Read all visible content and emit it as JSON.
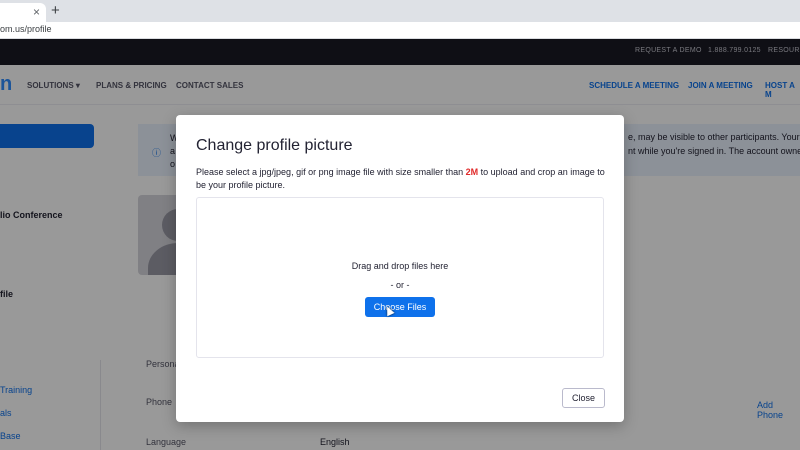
{
  "browser": {
    "tab_close": "×",
    "new_tab": "+",
    "url": "om.us/profile"
  },
  "topbar": {
    "request_demo": "REQUEST A DEMO",
    "phone": "1.888.799.0125",
    "resources": "RESOUR"
  },
  "nav": {
    "logo_fragment": "n",
    "solutions": "SOLUTIONS ▾",
    "plans": "PLANS & PRICING",
    "contact": "CONTACT SALES",
    "schedule": "SCHEDULE A MEETING",
    "join": "JOIN A MEETING",
    "host": "HOST A M"
  },
  "background": {
    "sidebar_conference": "lio Conference",
    "sidebar_profile": "file",
    "sidebar_training": "Training",
    "sidebar_als": "als",
    "sidebar_base": "Base",
    "notice_line1": "e, may be visible to other participants. Your na",
    "notice_line2": "nt while you're signed in. The account owner a",
    "notice_w": "W",
    "notice_a": "a",
    "notice_o": "o",
    "personal": "Persona",
    "phone_label": "Phone",
    "add_phone": "Add Phone",
    "language_label": "Language",
    "language_value": "English"
  },
  "modal": {
    "title": "Change profile picture",
    "desc_before": "Please select a jpg/jpeg, gif or png image file with size smaller than ",
    "size_limit": "2M",
    "desc_after": " to upload and crop an image to be your profile picture.",
    "drop_text": "Drag and drop files here",
    "or_text": "- or -",
    "choose_files": "Choose Files",
    "close": "Close"
  },
  "colors": {
    "brand_blue": "#0e71eb",
    "size_red": "#e02828"
  }
}
